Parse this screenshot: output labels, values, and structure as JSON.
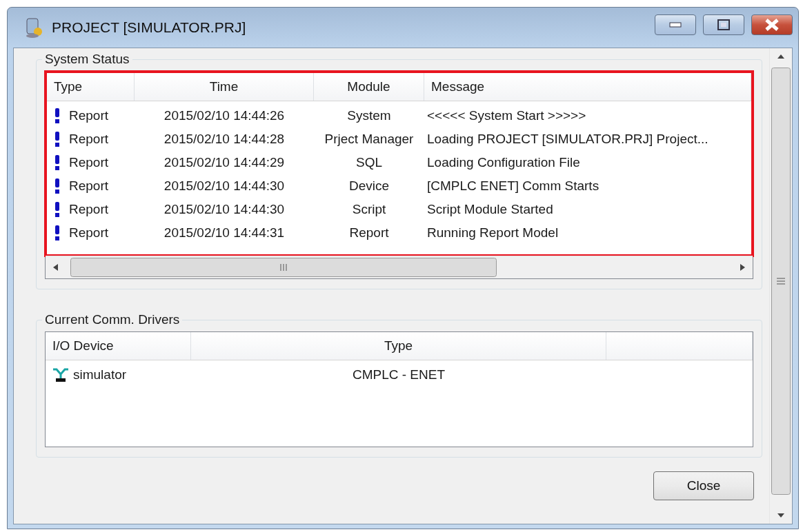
{
  "window": {
    "title": "PROJECT [SIMULATOR.PRJ]"
  },
  "system_status": {
    "title": "System Status",
    "columns": [
      "Type",
      "Time",
      "Module",
      "Message"
    ],
    "rows": [
      {
        "type": "Report",
        "time": "2015/02/10 14:44:26",
        "module": "System",
        "message": "<<<<< System Start >>>>>"
      },
      {
        "type": "Report",
        "time": "2015/02/10 14:44:28",
        "module": "Prject Manager",
        "message": "Loading PROJECT [SIMULATOR.PRJ] Project..."
      },
      {
        "type": "Report",
        "time": "2015/02/10 14:44:29",
        "module": "SQL",
        "message": "Loading Configuration File"
      },
      {
        "type": "Report",
        "time": "2015/02/10 14:44:30",
        "module": "Device",
        "message": "[CMPLC ENET] Comm Starts"
      },
      {
        "type": "Report",
        "time": "2015/02/10 14:44:30",
        "module": "Script",
        "message": "Script Module Started"
      },
      {
        "type": "Report",
        "time": "2015/02/10 14:44:31",
        "module": "Report",
        "message": "Running Report Model"
      }
    ]
  },
  "comm_drivers": {
    "title": "Current Comm. Drivers",
    "columns": [
      "I/O Device",
      "Type"
    ],
    "rows": [
      {
        "device": "simulator",
        "type": "CMPLC - ENET"
      }
    ]
  },
  "close_button": "Close"
}
